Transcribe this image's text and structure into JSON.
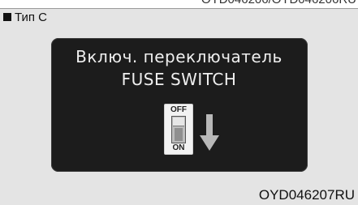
{
  "header": {
    "reference": "OYD046206/OYD046206RU",
    "type_label": "Тип C"
  },
  "panel": {
    "line1": "Включ. переключатель",
    "line2": "FUSE SWITCH",
    "switch_off_label": "OFF",
    "switch_on_label": "ON"
  },
  "footer": {
    "image_code": "OYD046207RU"
  },
  "colors": {
    "panel_background": "#1c1c1c",
    "panel_text": "#efefef",
    "page_background": "#e4e4e4"
  },
  "icons": [
    "fuse-switch-icon",
    "down-arrow-icon"
  ]
}
